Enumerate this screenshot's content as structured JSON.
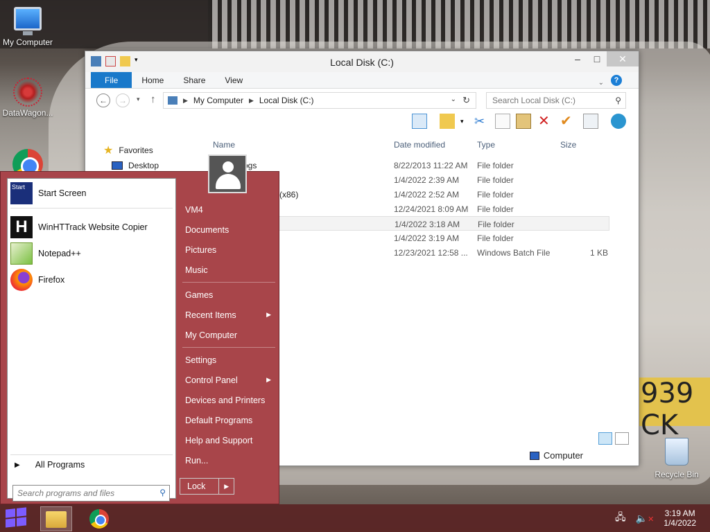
{
  "desktop": {
    "icons": [
      {
        "label": "My Computer",
        "icon": "monitor-icon"
      },
      {
        "label": "DataWagon...",
        "icon": "datawagon-shortcut-icon"
      },
      {
        "label": "",
        "icon": "chrome-icon"
      },
      {
        "label": "Recycle Bin",
        "icon": "recycle-bin-icon"
      }
    ]
  },
  "explorer": {
    "title": "Local Disk (C:)",
    "tabs": [
      "File",
      "Home",
      "Share",
      "View"
    ],
    "address": [
      "My Computer",
      "Local Disk (C:)"
    ],
    "search_placeholder": "Search Local Disk (C:)",
    "columns": {
      "name": "Name",
      "date": "Date modified",
      "type": "Type",
      "size": "Size"
    },
    "nav": {
      "favorites": "Favorites",
      "desktop": "Desktop"
    },
    "rows": [
      {
        "name": "ogs",
        "date": "8/22/2013 11:22 AM",
        "type": "File folder",
        "size": ""
      },
      {
        "name": "",
        "date": "1/4/2022 2:39 AM",
        "type": "File folder",
        "size": ""
      },
      {
        "name": "(x86)",
        "date": "1/4/2022 2:52 AM",
        "type": "File folder",
        "size": ""
      },
      {
        "name": "",
        "date": "12/24/2021 8:09 AM",
        "type": "File folder",
        "size": ""
      },
      {
        "name": "",
        "date": "1/4/2022 3:18 AM",
        "type": "File folder",
        "size": ""
      },
      {
        "name": "",
        "date": "1/4/2022 3:19 AM",
        "type": "File folder",
        "size": ""
      },
      {
        "name": "",
        "date": "12/23/2021 12:58 ...",
        "type": "Windows Batch File",
        "size": "1 KB"
      }
    ],
    "status_location": "Computer"
  },
  "start_menu": {
    "pinned": [
      {
        "label": "Start Screen",
        "icon": "start-screen-icon"
      },
      {
        "label": "WinHTTrack Website Copier",
        "icon": "httrack-icon"
      },
      {
        "label": "Notepad++",
        "icon": "notepadpp-icon"
      },
      {
        "label": "Firefox",
        "icon": "firefox-icon"
      }
    ],
    "all_programs": "All Programs",
    "search_placeholder": "Search programs and files",
    "right": {
      "group1": [
        "VM4",
        "Documents",
        "Pictures",
        "Music"
      ],
      "group2": [
        "Games",
        "Recent Items",
        "My Computer"
      ],
      "group3": [
        "Settings",
        "Control Panel",
        "Devices and Printers",
        "Default Programs",
        "Help and Support",
        "Run..."
      ]
    },
    "lock": "Lock"
  },
  "taskbar": {
    "time": "3:19 AM",
    "date": "1/4/2022"
  }
}
